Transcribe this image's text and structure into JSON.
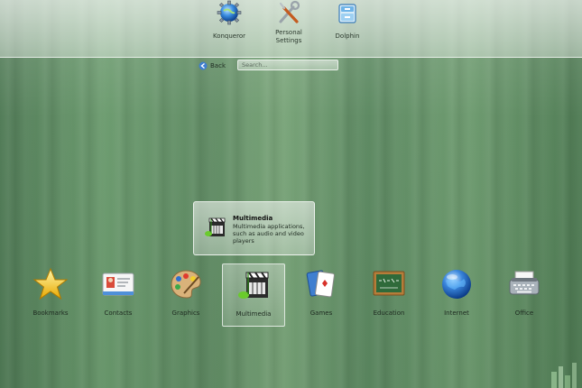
{
  "favorites": [
    {
      "label": "Konqueror",
      "icon": "konqueror-globe-icon"
    },
    {
      "label": "Personal Settings",
      "icon": "personal-settings-tools-icon"
    },
    {
      "label": "Dolphin",
      "icon": "dolphin-file-manager-icon"
    }
  ],
  "nav": {
    "back_label": "Back",
    "search_placeholder": "Search..."
  },
  "tooltip": {
    "title": "Multimedia",
    "description": "Multimedia applications, such as audio and video players",
    "icon": "multimedia-clapperboard-icon"
  },
  "categories": [
    {
      "label": "Bookmarks",
      "icon": "star-icon"
    },
    {
      "label": "Contacts",
      "icon": "contact-card-icon"
    },
    {
      "label": "Graphics",
      "icon": "paint-palette-icon"
    },
    {
      "label": "Multimedia",
      "icon": "multimedia-clapperboard-icon",
      "selected": true
    },
    {
      "label": "Games",
      "icon": "playing-cards-icon"
    },
    {
      "label": "Education",
      "icon": "chalkboard-icon"
    },
    {
      "label": "Internet",
      "icon": "globe-icon"
    },
    {
      "label": "Office",
      "icon": "typewriter-icon"
    }
  ],
  "colors": {
    "background": "#5e8a62",
    "label_text": "#1e2a20"
  }
}
